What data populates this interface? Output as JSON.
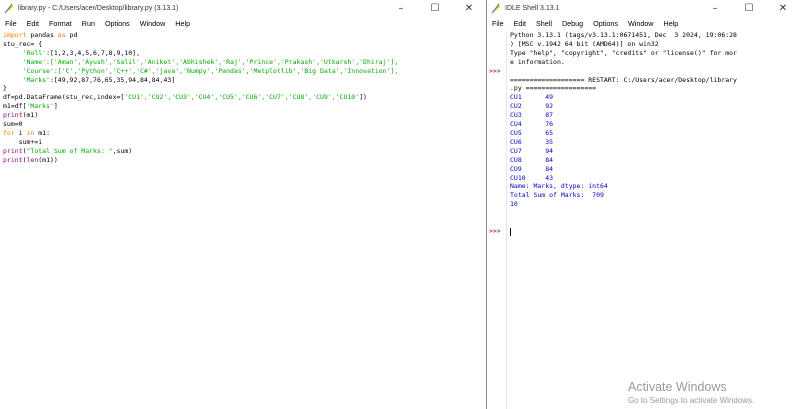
{
  "editor": {
    "title": "library.py - C:/Users/acer/Desktop/library.py (3.13.1)",
    "menu": [
      "File",
      "Edit",
      "Format",
      "Run",
      "Options",
      "Window",
      "Help"
    ],
    "code": {
      "l1_kw1": "import",
      "l1_mid": " pandas ",
      "l1_kw2": "as",
      "l1_end": " pd",
      "l2": "stu_rec= {",
      "l3_pre": "     ",
      "l3_str": "'Roll'",
      "l3_rest": ":[1,2,3,4,5,6,7,8,9,10],",
      "l4_pre": "     ",
      "l4_str": "'Name':['Aman','Ayush','Salil','Aniket','Abhishek','Raj','Prince','Prakash','Utkarsh','Dhiraj'],",
      "l5_pre": "     ",
      "l5_str": "'Course':['C','Python','C++','C#','java','Numpy','Pandas','Metplotlib','Big Data','Innovation'],",
      "l6_pre": "     ",
      "l6_str": "'Marks'",
      "l6_rest": ":[49,92,87,76,65,35,94,84,84,43]",
      "l7": "}",
      "l8_pre": "df=pd.DataFrame(stu_rec,index=[",
      "l8_str": "'CU1','CU2','CU3','CU4','CU5','CU6','CU7','CU8','CU9','CU10'",
      "l8_end": "])",
      "l9_pre": "m1=df[",
      "l9_str": "'Marks'",
      "l9_end": "]",
      "l10_bi": "print",
      "l10_end": "(m1)",
      "l11": "sum=0",
      "l12_kw1": "for",
      "l12_mid": " i ",
      "l12_kw2": "in",
      "l12_end": " m1:",
      "l13": "    sum+=i",
      "l14_bi": "print",
      "l14_open": "(",
      "l14_str": "\"Total Sum of Marks: \"",
      "l14_end": ",sum)",
      "l15_bi1": "print",
      "l15_open": "(",
      "l15_bi2": "len",
      "l15_end": "(m1))"
    }
  },
  "shell": {
    "title": "IDLE Shell 3.13.1",
    "menu": [
      "File",
      "Edit",
      "Shell",
      "Debug",
      "Options",
      "Window",
      "Help"
    ],
    "banner": [
      "Python 3.13.1 (tags/v3.13.1:0671451, Dec  3 2024, 19:06:28",
      ") [MSC v.1942 64 bit (AMD64)] on win32",
      "Type \"help\", \"copyright\", \"credits\" or \"license()\" for mor",
      "e information."
    ],
    "restart": [
      "=================== RESTART: C:/Users/acer/Desktop/library",
      ".py =================="
    ],
    "output": [
      "CU1      49",
      "CU2      92",
      "CU3      87",
      "CU4      76",
      "CU5      65",
      "CU6      35",
      "CU7      94",
      "CU8      84",
      "CU9      84",
      "CU10     43",
      "Name: Marks, dtype: int64",
      "Total Sum of Marks:  709",
      "10"
    ],
    "prompt": ">>>"
  },
  "watermark": {
    "title": "Activate Windows",
    "subtitle": "Go to Settings to activate Windows."
  },
  "icons": {
    "app": "idle-feather-icon",
    "minimize": "minimize-icon",
    "maximize": "maximize-icon",
    "close": "close-icon"
  }
}
